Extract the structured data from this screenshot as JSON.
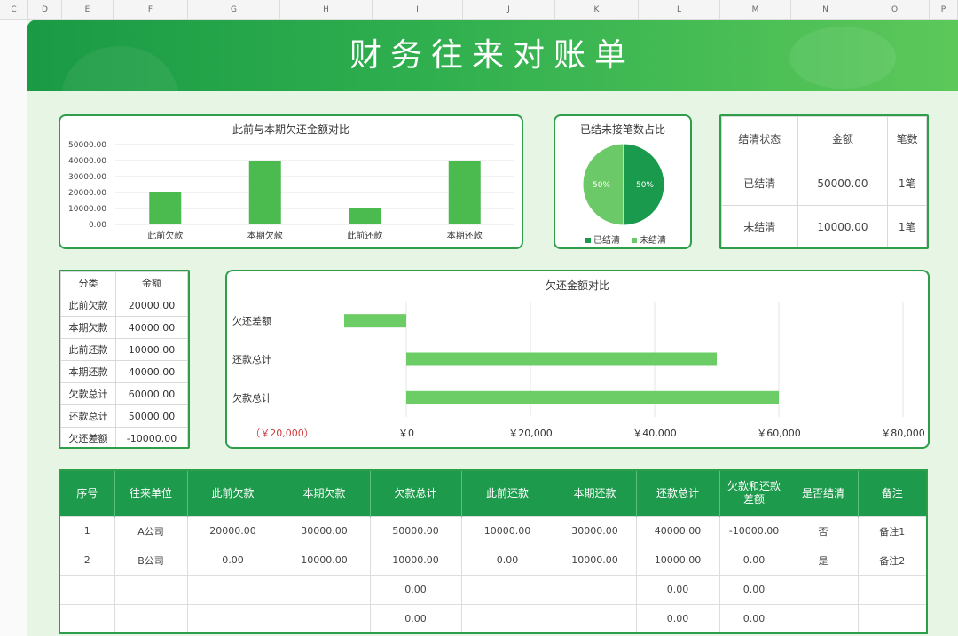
{
  "columns": [
    "C",
    "D",
    "E",
    "F",
    "G",
    "H",
    "I",
    "J",
    "K",
    "L",
    "M",
    "N",
    "O",
    "P"
  ],
  "title": "财务往来对账单",
  "bar_chart": {
    "title": "此前与本期欠还金额对比",
    "y_ticks": [
      "50000.00",
      "40000.00",
      "30000.00",
      "20000.00",
      "10000.00",
      "0.00"
    ]
  },
  "pie_chart": {
    "title": "已结未接笔数占比",
    "label_a": "50%",
    "label_b": "50%",
    "legend_a": "已结清",
    "legend_b": "未结清"
  },
  "status_table": {
    "headers": [
      "结清状态",
      "金额",
      "笔数"
    ],
    "rows": [
      [
        "已结清",
        "50000.00",
        "1笔"
      ],
      [
        "未结清",
        "10000.00",
        "1笔"
      ]
    ]
  },
  "category_table": {
    "headers": [
      "分类",
      "金额"
    ],
    "rows": [
      [
        "此前欠款",
        "20000.00"
      ],
      [
        "本期欠款",
        "40000.00"
      ],
      [
        "此前还款",
        "10000.00"
      ],
      [
        "本期还款",
        "40000.00"
      ],
      [
        "欠款总计",
        "60000.00"
      ],
      [
        "还款总计",
        "50000.00"
      ],
      [
        "欠还差额",
        "-10000.00"
      ]
    ]
  },
  "hbar_chart": {
    "title": "欠还金额对比",
    "x_ticks": [
      "（￥20,000）",
      "￥0",
      "￥20,000",
      "￥40,000",
      "￥60,000",
      "￥80,000"
    ]
  },
  "detail_table": {
    "headers": [
      "序号",
      "往来单位",
      "此前欠款",
      "本期欠款",
      "欠款总计",
      "此前还款",
      "本期还款",
      "还款总计",
      "欠款和还款差额",
      "是否结清",
      "备注"
    ],
    "rows": [
      [
        "1",
        "A公司",
        "20000.00",
        "30000.00",
        "50000.00",
        "10000.00",
        "30000.00",
        "40000.00",
        "-10000.00",
        "否",
        "备注1"
      ],
      [
        "2",
        "B公司",
        "0.00",
        "10000.00",
        "10000.00",
        "0.00",
        "10000.00",
        "10000.00",
        "0.00",
        "是",
        "备注2"
      ],
      [
        "",
        "",
        "",
        "",
        "0.00",
        "",
        "",
        "0.00",
        "0.00",
        "",
        ""
      ],
      [
        "",
        "",
        "",
        "",
        "0.00",
        "",
        "",
        "0.00",
        "0.00",
        "",
        ""
      ]
    ]
  },
  "colors": {
    "accent": "#1e9a4c",
    "bar": "#4cbb4f",
    "hbar": "#6ccc66",
    "pie_a": "#1a9a4c",
    "pie_b": "#6cc967",
    "negative": "#d23c3c"
  },
  "chart_data": [
    {
      "type": "bar",
      "title": "此前与本期欠还金额对比",
      "categories": [
        "此前欠款",
        "本期欠款",
        "此前还款",
        "本期还款"
      ],
      "values": [
        20000,
        40000,
        10000,
        40000
      ],
      "ylim": [
        0,
        50000
      ]
    },
    {
      "type": "pie",
      "title": "已结未接笔数占比",
      "categories": [
        "已结清",
        "未结清"
      ],
      "values": [
        50,
        50
      ]
    },
    {
      "type": "bar",
      "title": "欠还金额对比",
      "orientation": "horizontal",
      "categories": [
        "欠还差额",
        "还款总计",
        "欠款总计"
      ],
      "values": [
        -10000,
        50000,
        60000
      ],
      "xlim": [
        -20000,
        80000
      ]
    }
  ]
}
